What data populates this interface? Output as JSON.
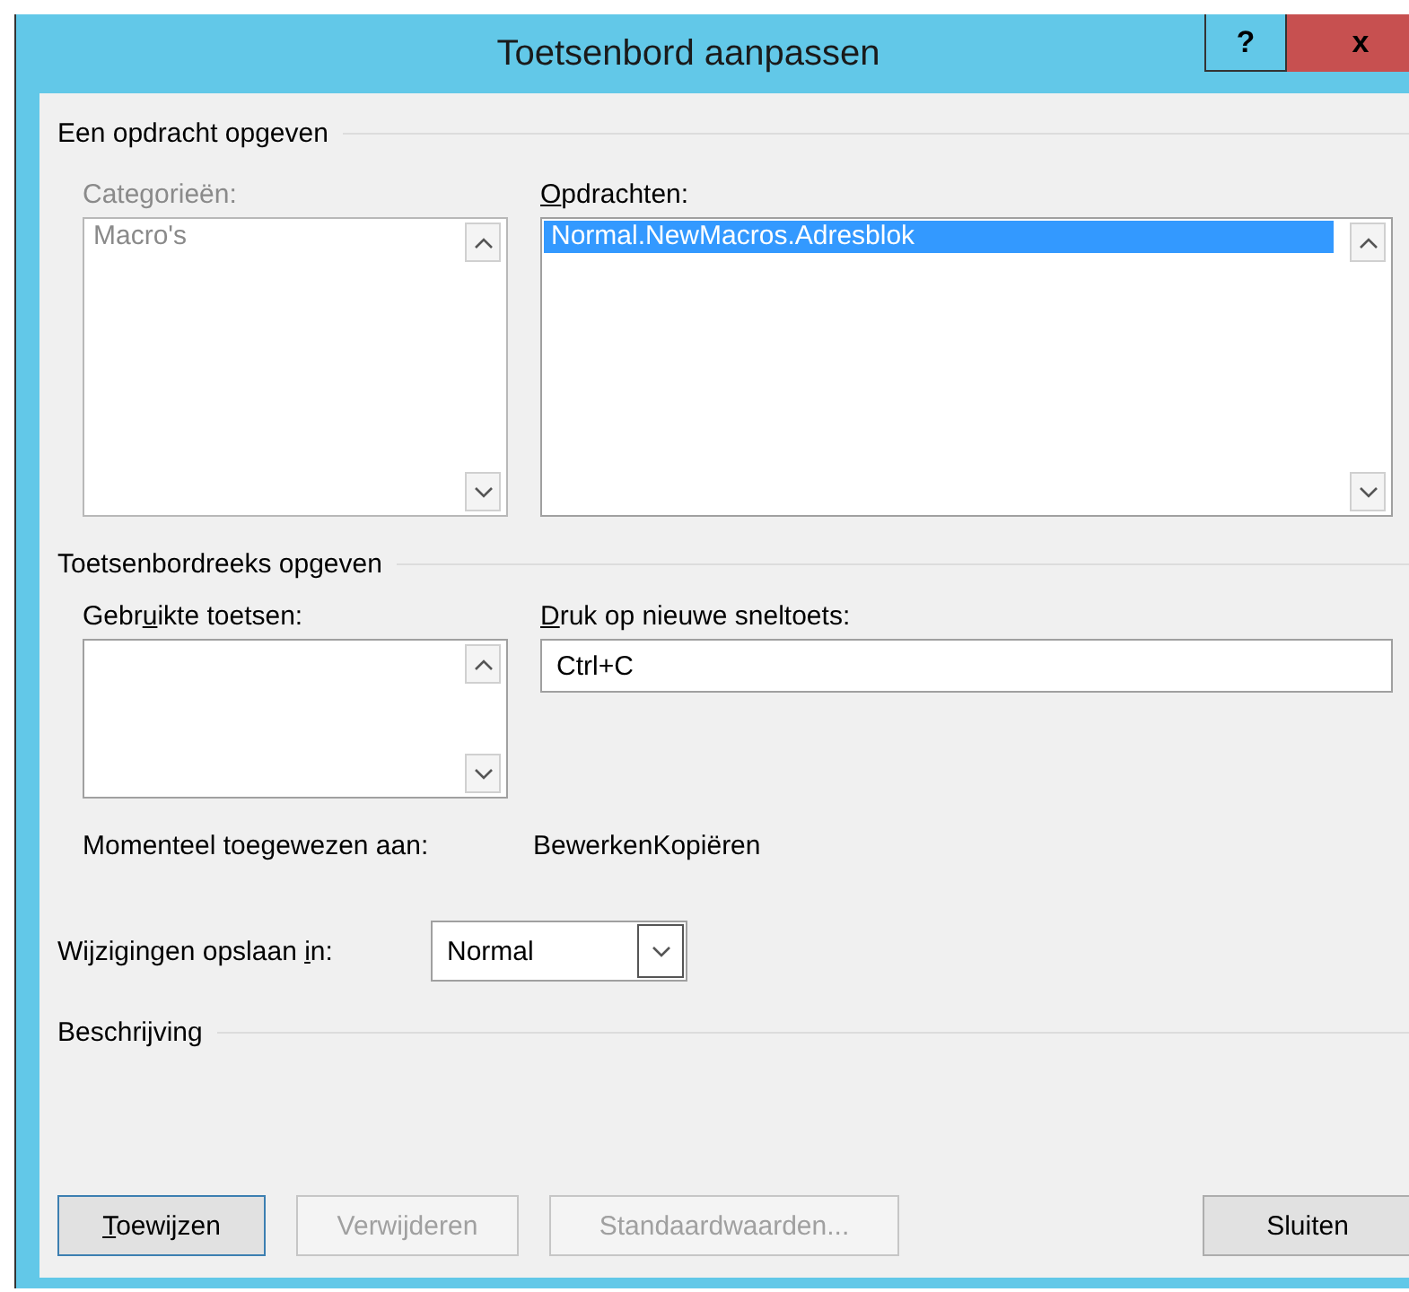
{
  "window": {
    "title": "Toetsenbord aanpassen",
    "buttons": [
      {
        "kind": "help",
        "label": "?"
      },
      {
        "kind": "close",
        "label": "x"
      }
    ]
  },
  "command_section": {
    "title": "Een opdracht opgeven",
    "categories": {
      "label": {
        "before": "Categorieën:"
      },
      "disabled": true,
      "items": [
        {
          "text": "Macro's",
          "selected": false
        }
      ]
    },
    "commands": {
      "label": {
        "key": "O",
        "after": "pdrachten:"
      },
      "items": [
        {
          "text": "Normal.NewMacros.Adresblok",
          "selected": true
        }
      ]
    }
  },
  "keys_section": {
    "title": "Toetsenbordreeks opgeven",
    "current_keys": {
      "label": {
        "before": "Gebr",
        "key": "u",
        "after": "ikte toetsen:"
      }
    },
    "new_shortcut": {
      "label": {
        "key": "D",
        "after": "ruk op nieuwe sneltoets:"
      },
      "value": "Ctrl+C"
    },
    "assigned_label": "Momenteel toegewezen aan:",
    "assigned_value": "BewerkenKopiëren"
  },
  "save_in": {
    "label": {
      "before": "Wijzigingen opslaan ",
      "key": "i",
      "after": "n:"
    },
    "value": "Normal"
  },
  "description": {
    "title": "Beschrijving"
  },
  "buttons": [
    {
      "label": {
        "key": "T",
        "after": "oewijzen"
      },
      "disabled": false,
      "default": true
    },
    {
      "label": {
        "before": "Verwijderen"
      },
      "disabled": true,
      "default": false
    },
    {
      "label": {
        "before": "Standaardwaarden..."
      },
      "disabled": true,
      "default": false
    },
    {
      "label": {
        "before": "Sluiten"
      },
      "disabled": false,
      "default": false
    }
  ]
}
